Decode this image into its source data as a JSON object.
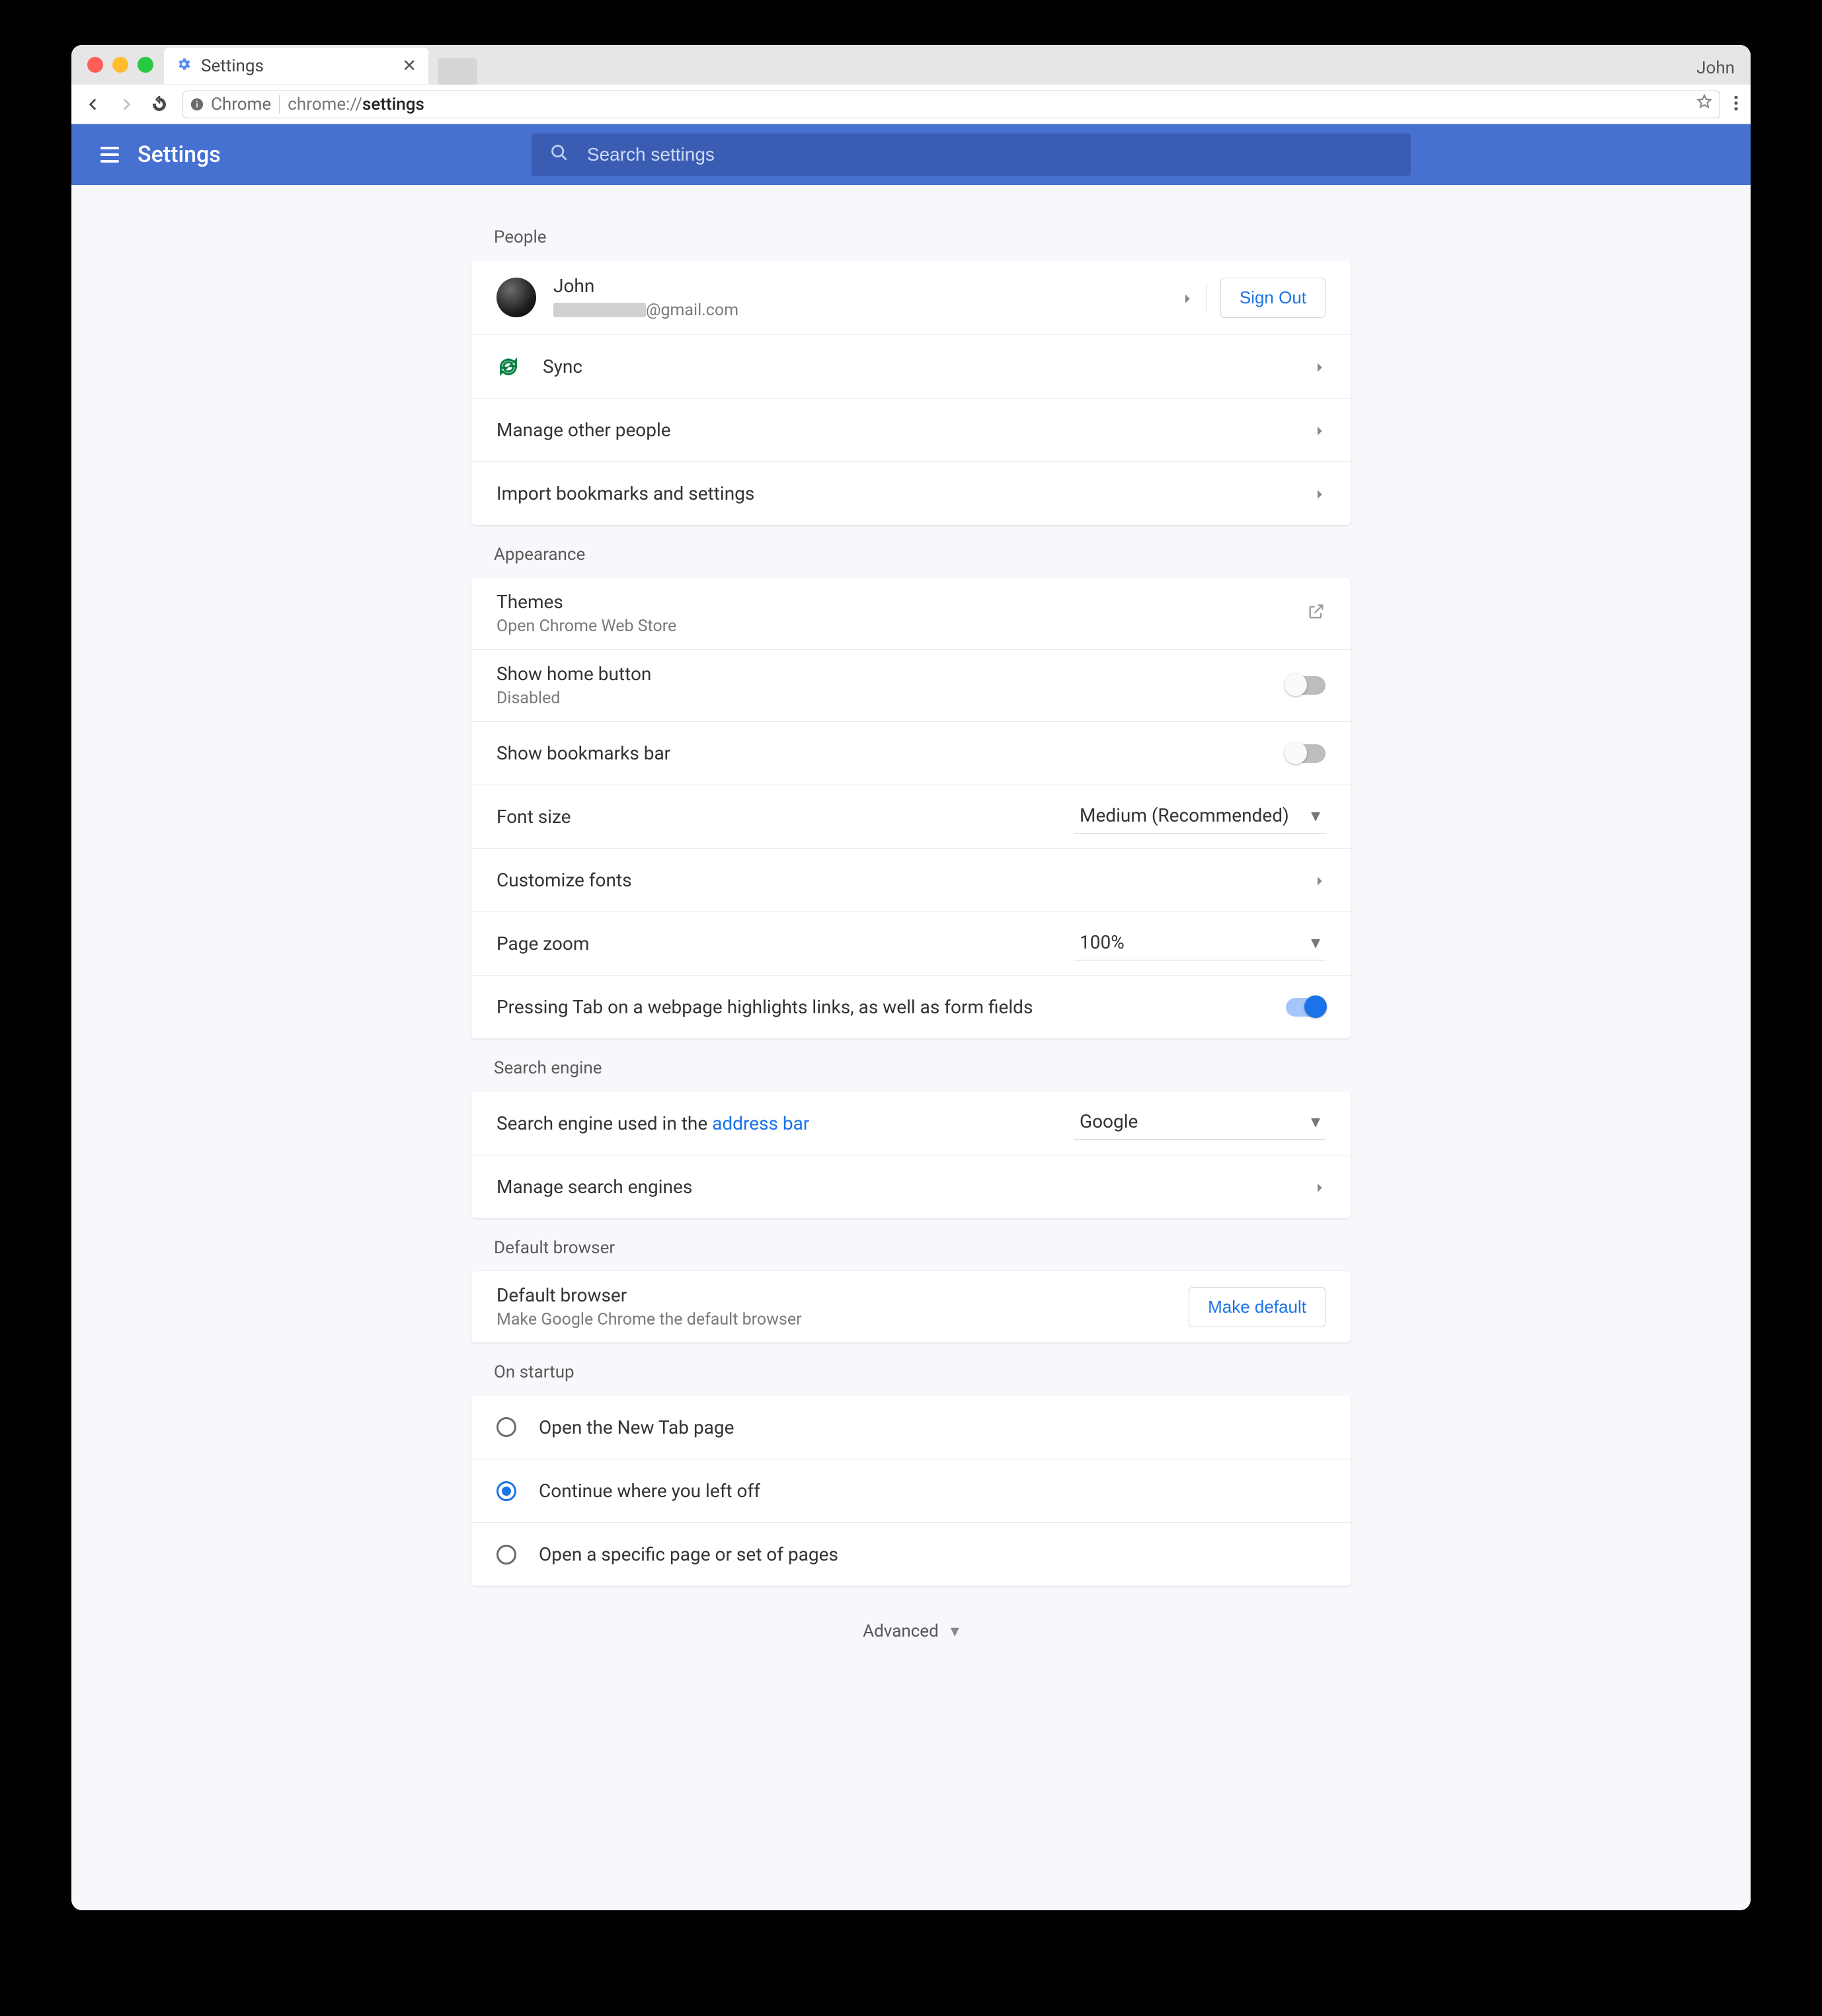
{
  "browser": {
    "tab_title": "Settings",
    "profile_name": "John",
    "omnibox_brand": "Chrome",
    "omnibox_url_prefix": "chrome://",
    "omnibox_url_bold": "settings"
  },
  "header": {
    "title": "Settings",
    "search_placeholder": "Search settings"
  },
  "sections": {
    "people": {
      "label": "People",
      "user_name": "John",
      "user_email_suffix": "@gmail.com",
      "sign_out": "Sign Out",
      "sync": "Sync",
      "manage_people": "Manage other people",
      "import": "Import bookmarks and settings"
    },
    "appearance": {
      "label": "Appearance",
      "themes": "Themes",
      "themes_sub": "Open Chrome Web Store",
      "home_button": "Show home button",
      "home_button_sub": "Disabled",
      "bookmarks_bar": "Show bookmarks bar",
      "font_size": "Font size",
      "font_size_value": "Medium (Recommended)",
      "customize_fonts": "Customize fonts",
      "page_zoom": "Page zoom",
      "page_zoom_value": "100%",
      "tab_highlight": "Pressing Tab on a webpage highlights links, as well as form fields"
    },
    "search": {
      "label": "Search engine",
      "row1_prefix": "Search engine used in the ",
      "row1_link": "address bar",
      "engine_value": "Google",
      "manage": "Manage search engines"
    },
    "default_browser": {
      "label": "Default browser",
      "title": "Default browser",
      "sub": "Make Google Chrome the default browser",
      "button": "Make default"
    },
    "startup": {
      "label": "On startup",
      "opt1": "Open the New Tab page",
      "opt2": "Continue where you left off",
      "opt3": "Open a specific page or set of pages",
      "selected": 1
    },
    "advanced": "Advanced"
  }
}
